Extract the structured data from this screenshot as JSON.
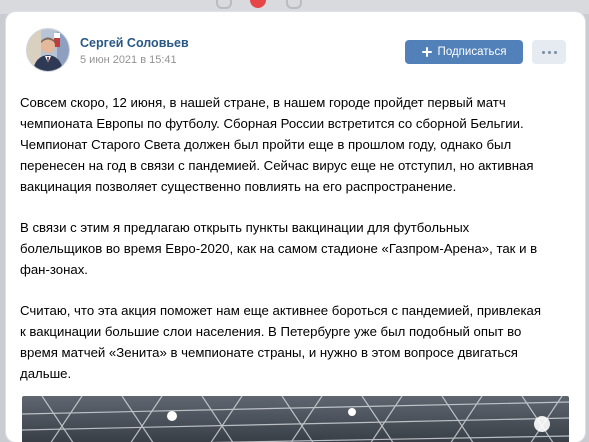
{
  "post": {
    "author_name": "Сергей Соловьев",
    "date": "5 июн 2021 в 15:41",
    "subscribe_label": "Подписаться",
    "paragraphs": [
      "Совсем скоро, 12 июня, в нашей стране, в нашем городе пройдет первый матч\nчемпионата Европы по футболу. Сборная России встретится со сборной Бельгии.\nЧемпионат Старого Света должен был пройти еще в прошлом году, однако был\nперенесен на год в связи с пандемией. Сейчас вирус еще не отступил, но активная\nвакцинация позволяет существенно повлиять на его распространение.",
      "В связи с этим я предлагаю открыть пункты вакцинации для футбольных\nболельщиков во время Евро-2020, как на самом стадионе «Газпром-Арена», так и в\nфан-зонах.",
      "Считаю, что эта акция поможет нам еще активнее бороться с пандемией, привлекая\nк вакцинации большие слои населения. В Петербурге уже был подобный опыт во\nвремя матчей «Зенита» в чемпионате страны, и нужно в этом вопросе двигаться\nдальше."
    ]
  },
  "icons": {
    "plus": "plus-icon",
    "more": "more-dots-icon",
    "notification": "notification-badge-icon"
  },
  "colors": {
    "author_link": "#2a5885",
    "button_primary": "#5181b8",
    "button_secondary": "#e5ebf1",
    "date_text": "#939393"
  }
}
